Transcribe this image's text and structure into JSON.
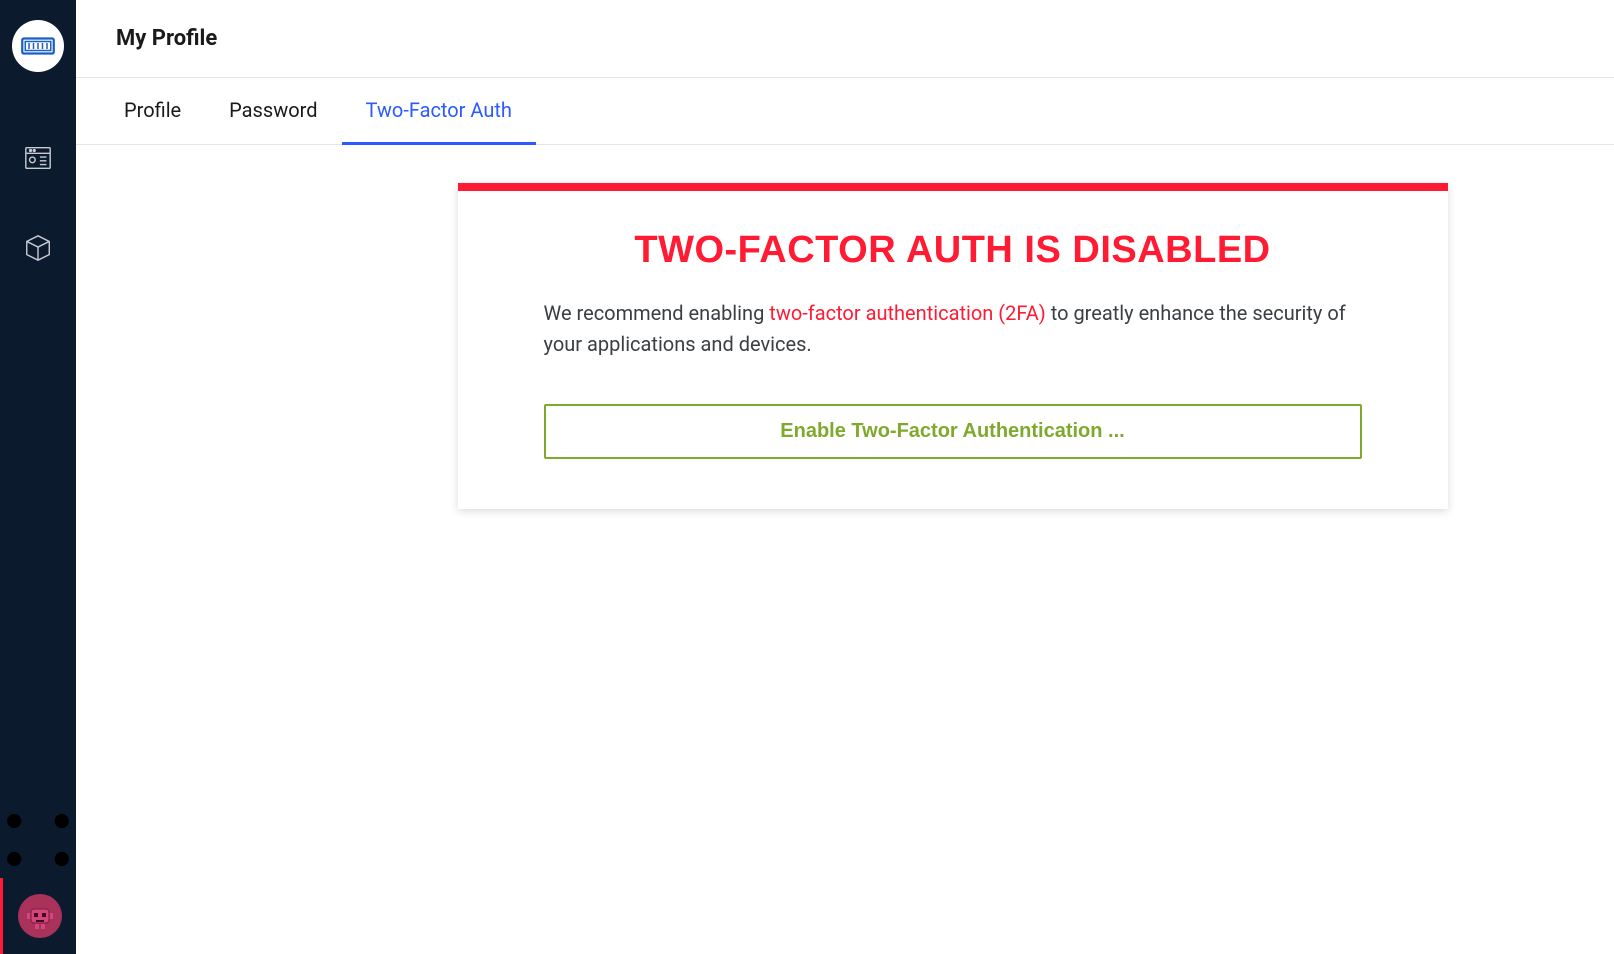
{
  "header": {
    "title": "My Profile"
  },
  "tabs": {
    "profile": "Profile",
    "password": "Password",
    "twofa": "Two-Factor Auth",
    "active": "twofa"
  },
  "card": {
    "heading": "TWO-FACTOR AUTH IS DISABLED",
    "body_pre": "We recommend enabling ",
    "body_link": "two-factor authentication (2FA)",
    "body_post": " to greatly enhance the security of your applications and devices.",
    "button": "Enable Two-Factor Authentication ..."
  },
  "colors": {
    "accent_red": "#ff1b33",
    "accent_green": "#7fa92d",
    "tab_active": "#2b5bff",
    "sidebar_bg": "#0c1a2e"
  },
  "sidebar": {
    "logo": "weg-logo",
    "items": [
      {
        "name": "dashboard",
        "icon": "dashboard-icon"
      },
      {
        "name": "packages",
        "icon": "package-icon"
      }
    ],
    "bottom_items": [
      {
        "name": "graph",
        "icon": "graph-icon"
      }
    ],
    "avatar": "robot-avatar"
  }
}
